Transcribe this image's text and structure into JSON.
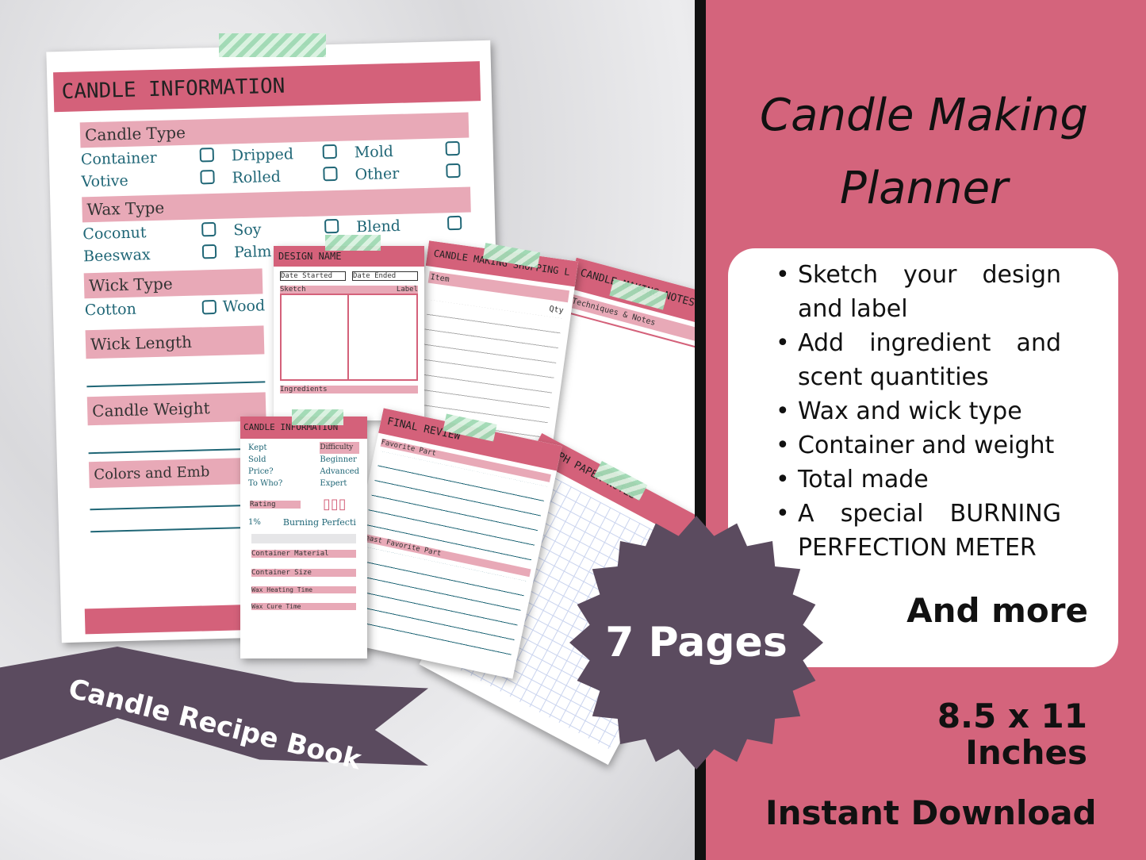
{
  "colors": {
    "brand_pink": "#d4647c",
    "accent_purple": "#5b4b5f",
    "teal": "#1f6676",
    "light_pink": "#e8a9b7"
  },
  "main_page": {
    "title": "CANDLE INFORMATION",
    "candle_type": {
      "label": "Candle Type",
      "options": [
        "Container",
        "Dripped",
        "Mold",
        "Votive",
        "Rolled",
        "Other"
      ]
    },
    "wax_type": {
      "label": "Wax Type",
      "options": [
        "Coconut",
        "Soy",
        "Blend",
        "Beeswax",
        "Palm"
      ]
    },
    "wick_type": {
      "label": "Wick Type",
      "options": [
        "Cotton",
        "Wood"
      ]
    },
    "wick_length": "Wick Length",
    "candle_weight": "Candle Weight",
    "colors": "Colors and Emb"
  },
  "design_page": {
    "title": "DESIGN NAME",
    "date_started": "Date Started",
    "date_ended": "Date Ended",
    "sketch": "Sketch",
    "label": "Label",
    "ingredients": "Ingredients"
  },
  "shopping_page": {
    "title": "CANDLE MAKING SHOPPING L",
    "item": "Item",
    "qty": "Qty"
  },
  "notes_page": {
    "title": "CANDLE MAKING NOTES",
    "sub": "Techniques & Notes"
  },
  "info_page": {
    "title": "CANDLE INFORMATION",
    "kept": "Kept",
    "sold": "Sold",
    "price": "Price?",
    "to_who": "To Who?",
    "difficulty": "Difficulty",
    "levels": [
      "Beginner",
      "Advanced",
      "Expert"
    ],
    "rating": "Rating",
    "percent": "1%",
    "burning": "Burning Perfecti",
    "fields": [
      "Container Material",
      "Container Size",
      "Wax Heating Time",
      "Wax Cure Time"
    ]
  },
  "review_page": {
    "title": "FINAL REVIEW",
    "favorite": "Favorite Part",
    "least": "Least Favorite Part"
  },
  "graph_page": {
    "title": "GRAPH PAPER NOTES"
  },
  "ribbon": "Candle Recipe Book",
  "badge": "7 Pages",
  "panel": {
    "title_line1": "Candle Making",
    "title_line2": "Planner",
    "features": [
      "Sketch your design and label",
      "Add ingredient and scent quantities",
      "Wax and wick type",
      "Container and weight",
      "Total made",
      "A special BURNING PERFECTION METER"
    ],
    "more": "And more",
    "size_line1": "8.5 x 11",
    "size_line2": "Inches",
    "download": "Instant Download"
  }
}
